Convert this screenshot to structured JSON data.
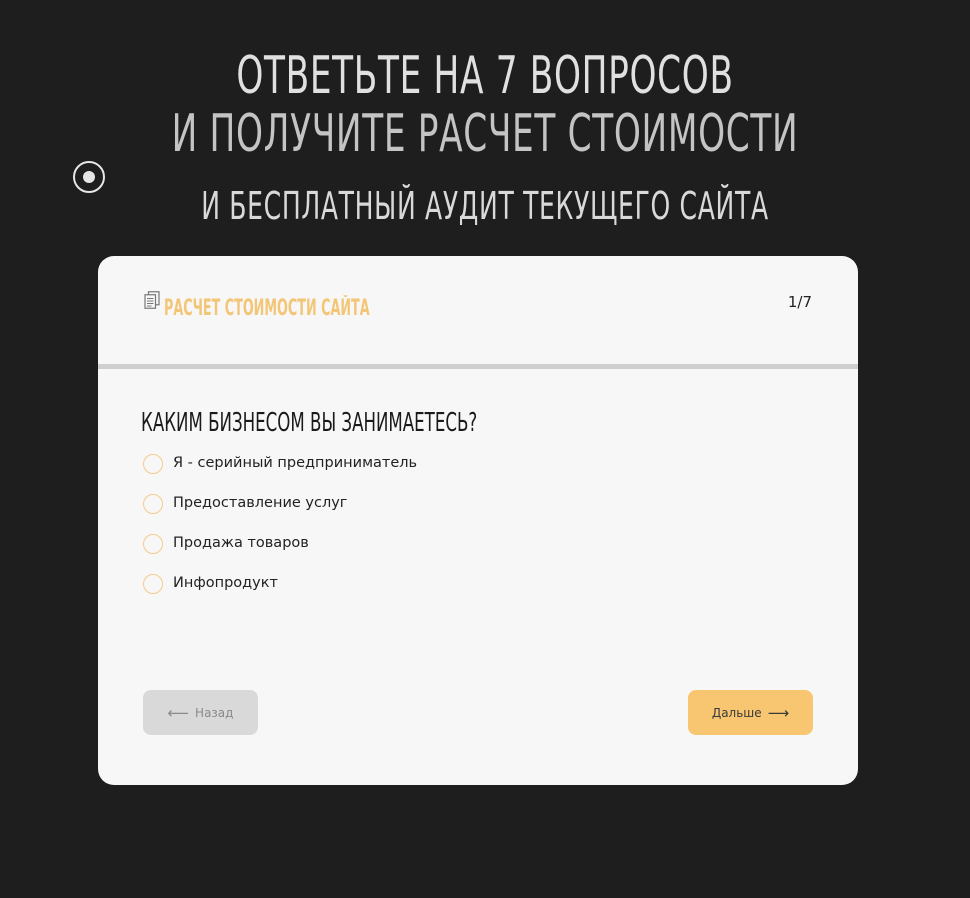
{
  "hero": {
    "line1": "Ответьте на 7 вопросов",
    "line2": "и получите расчет стоимости",
    "subtitle": "и бесплатный аудит текущего сайта"
  },
  "quiz": {
    "title": "Расчет стоимости сайта",
    "title_icon": "document-icon",
    "counter": "1/7",
    "question": "Каким бизнесом вы занимаетесь?",
    "options": [
      {
        "label": "Я - серийный предприниматель",
        "selected": false
      },
      {
        "label": "Предоставление услуг",
        "selected": false
      },
      {
        "label": "Продажа товаров",
        "selected": false
      },
      {
        "label": "Инфопродукт",
        "selected": false
      }
    ],
    "back": {
      "label": "Назад",
      "arrow": "⟵",
      "enabled": false
    },
    "next": {
      "label": "Дальше",
      "arrow": "⟶"
    }
  },
  "colors": {
    "background": "#1e1e1e",
    "card": "#f7f7f7",
    "accent": "#f8c671",
    "title_accent": "#f3c677"
  }
}
